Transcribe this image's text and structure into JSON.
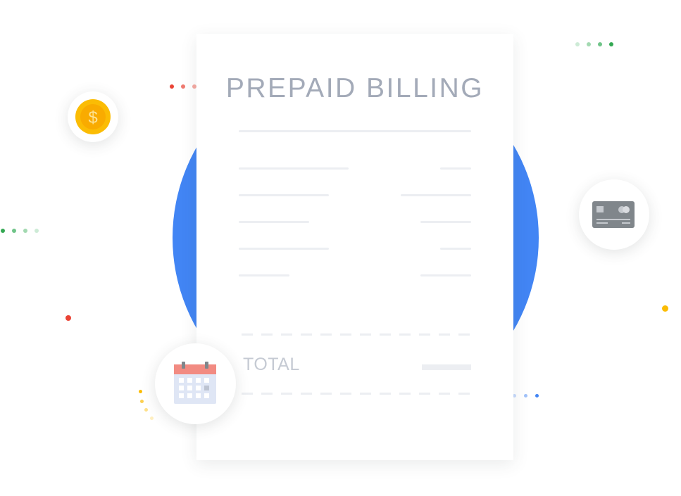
{
  "receipt": {
    "title": "PREPAID BILLING",
    "total_label": "TOTAL"
  },
  "icons": {
    "coin": "dollar-coin-icon",
    "card": "credit-card-icon",
    "calendar": "calendar-icon",
    "coin_symbol": "$"
  },
  "colors": {
    "blue": "#4285f4",
    "red": "#ea4335",
    "yellow": "#fbbc04",
    "green": "#34a853",
    "gray_text": "#a3aab8"
  }
}
